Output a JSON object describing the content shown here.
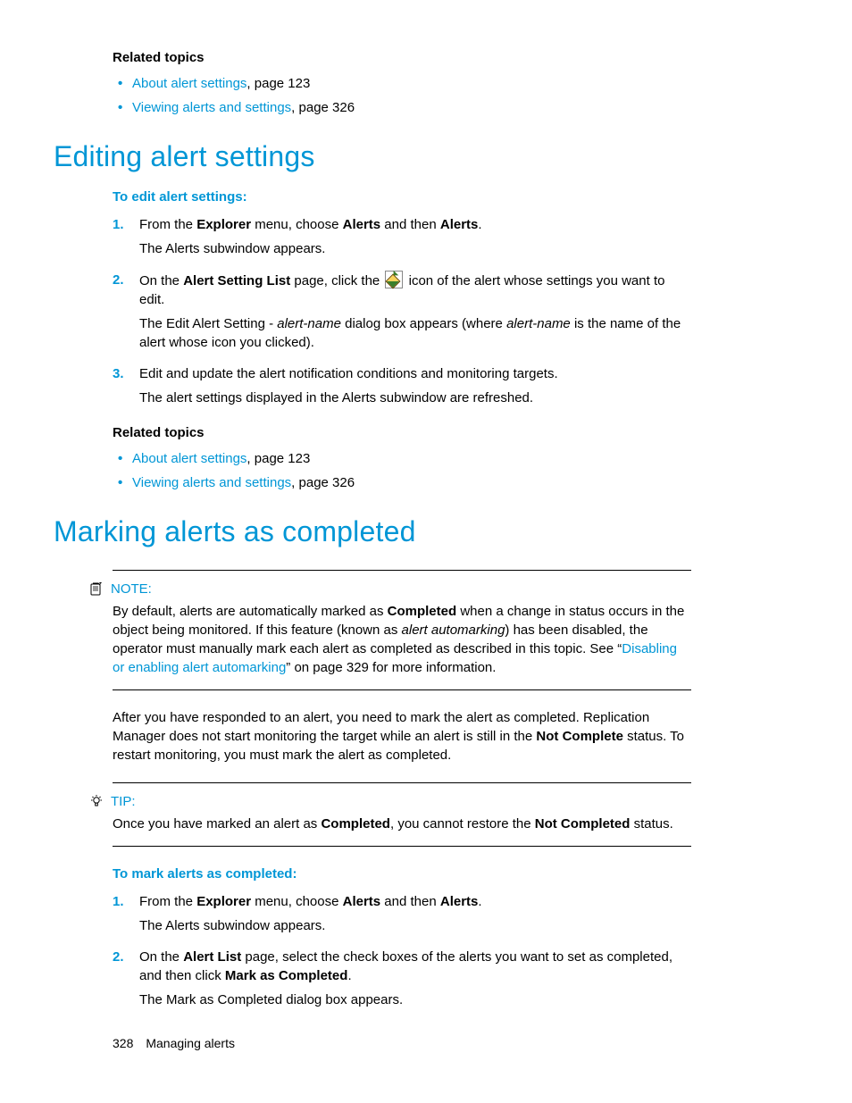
{
  "related1": {
    "heading": "Related topics",
    "items": [
      {
        "link": "About alert settings",
        "suffix": ", page 123"
      },
      {
        "link": "Viewing alerts and settings",
        "suffix": ", page 326"
      }
    ]
  },
  "section1": {
    "title": "Editing alert settings",
    "proc_heading": "To edit alert settings:",
    "steps": {
      "s1_num": "1.",
      "s1_a": "From the ",
      "s1_b": "Explorer",
      "s1_c": " menu, choose ",
      "s1_d": "Alerts",
      "s1_e": " and then ",
      "s1_f": "Alerts",
      "s1_g": ".",
      "s1_p2": "The Alerts subwindow appears.",
      "s2_num": "2.",
      "s2_a": "On the ",
      "s2_b": "Alert Setting List",
      "s2_c": " page, click the ",
      "s2_d": " icon of the alert whose settings you want to edit.",
      "s2_p2a": "The Edit Alert Setting - ",
      "s2_p2b": "alert-name",
      "s2_p2c": " dialog box appears (where ",
      "s2_p2d": "alert-name",
      "s2_p2e": " is the name of the alert whose icon you clicked).",
      "s3_num": "3.",
      "s3_a": "Edit and update the alert notification conditions and monitoring targets.",
      "s3_p2": "The alert settings displayed in the Alerts subwindow are refreshed."
    }
  },
  "related2": {
    "heading": "Related topics",
    "items": [
      {
        "link": "About alert settings",
        "suffix": ", page 123"
      },
      {
        "link": "Viewing alerts and settings",
        "suffix": ", page 326"
      }
    ]
  },
  "section2": {
    "title": "Marking alerts as completed",
    "note_label": "NOTE:",
    "note_a": "By default, alerts are automatically marked as ",
    "note_b": "Completed",
    "note_c": " when a change in status occurs in the object being monitored. If this feature (known as ",
    "note_d": "alert automarking",
    "note_e": ") has been disabled, the operator must manually mark each alert as completed as described in this topic. See “",
    "note_link": "Disabling or enabling alert automarking",
    "note_f": "” on page 329 for more information.",
    "para_a": "After you have responded to an alert, you need to mark the alert as completed. Replication Manager does not start monitoring the target while an alert is still in the ",
    "para_b": "Not Complete",
    "para_c": " status. To restart monitoring, you must mark the alert as completed.",
    "tip_label": "TIP:",
    "tip_a": "Once you have marked an alert as ",
    "tip_b": "Completed",
    "tip_c": ", you cannot restore the ",
    "tip_d": "Not Completed",
    "tip_e": " status.",
    "proc_heading": "To mark alerts as completed:",
    "steps": {
      "s1_num": "1.",
      "s1_a": "From the ",
      "s1_b": "Explorer",
      "s1_c": " menu, choose ",
      "s1_d": "Alerts",
      "s1_e": " and then ",
      "s1_f": "Alerts",
      "s1_g": ".",
      "s1_p2": "The Alerts subwindow appears.",
      "s2_num": "2.",
      "s2_a": "On the ",
      "s2_b": "Alert List",
      "s2_c": " page, select the check boxes of the alerts you want to set as completed, and then click ",
      "s2_d": "Mark as Completed",
      "s2_e": ".",
      "s2_p2": "The Mark as Completed dialog box appears."
    }
  },
  "footer": {
    "page": "328",
    "chapter": "Managing alerts"
  }
}
